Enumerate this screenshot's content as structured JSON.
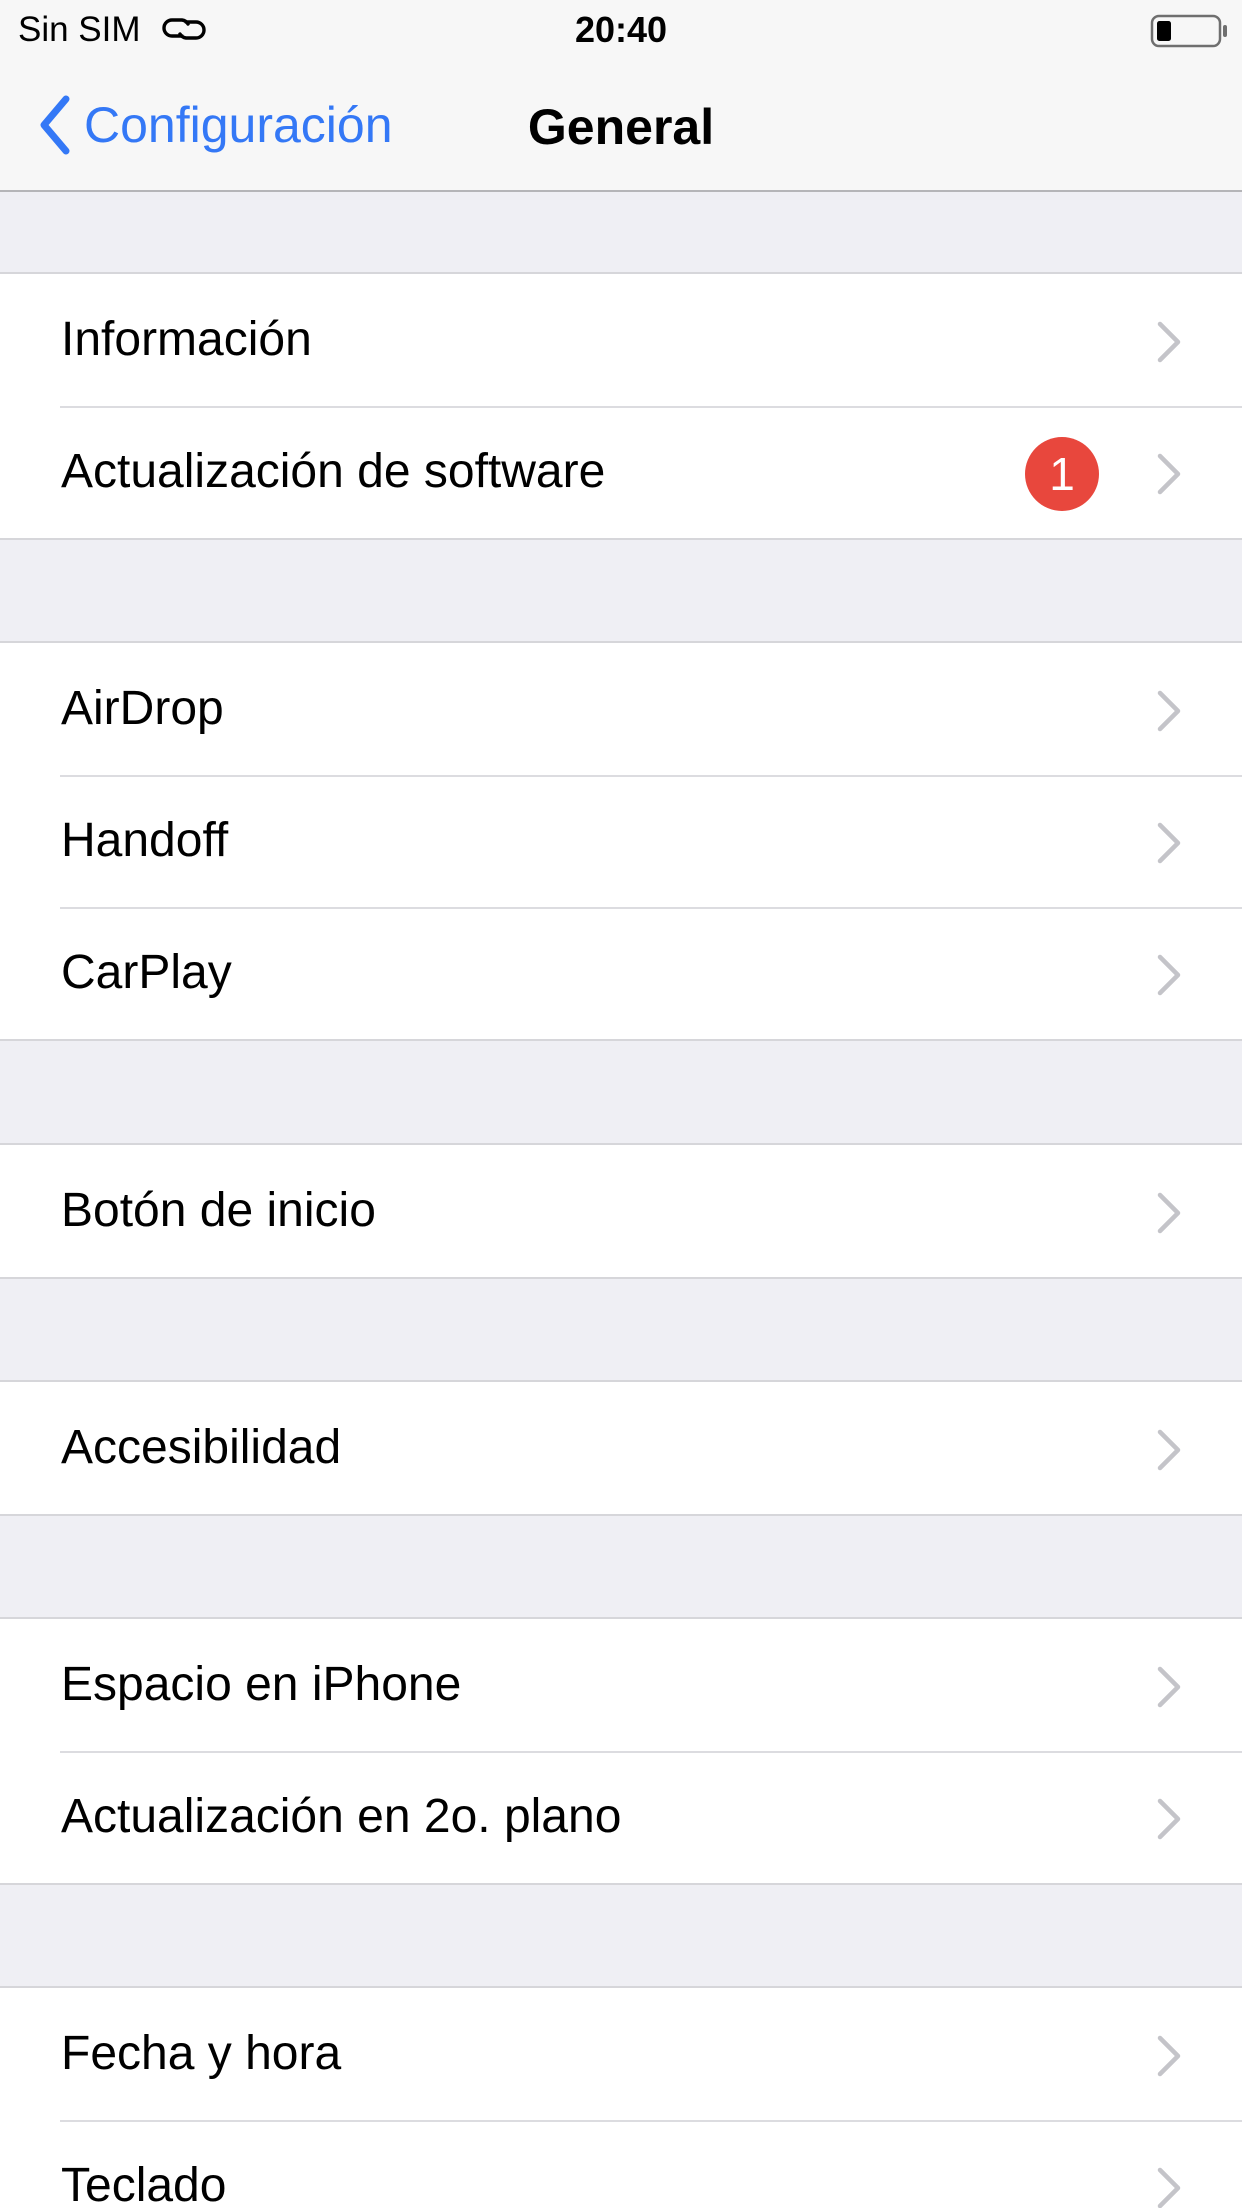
{
  "status_bar": {
    "carrier": "Sin SIM",
    "time": "20:40",
    "battery_icon": "battery-low-icon",
    "link_icon": "personal-hotspot-link-icon"
  },
  "nav": {
    "back_label": "Configuración",
    "title": "General",
    "accent_color": "#3478f6"
  },
  "groups": [
    {
      "items": [
        {
          "label": "Información"
        },
        {
          "label": "Actualización de software",
          "badge": "1",
          "badge_color": "#e8473d"
        }
      ]
    },
    {
      "items": [
        {
          "label": "AirDrop"
        },
        {
          "label": "Handoff"
        },
        {
          "label": "CarPlay"
        }
      ]
    },
    {
      "items": [
        {
          "label": "Botón de inicio"
        }
      ]
    },
    {
      "items": [
        {
          "label": "Accesibilidad"
        }
      ]
    },
    {
      "items": [
        {
          "label": "Espacio en iPhone"
        },
        {
          "label": "Actualización en 2o. plano"
        }
      ]
    },
    {
      "items": [
        {
          "label": "Fecha y hora"
        },
        {
          "label": "Teclado"
        }
      ]
    }
  ]
}
